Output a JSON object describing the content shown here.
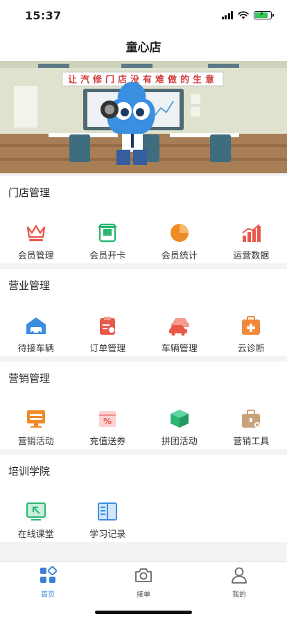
{
  "status_bar": {
    "time": "15:37"
  },
  "header": {
    "title": "童心店"
  },
  "banner": {
    "slogan": "让汽修门店没有难做的生意"
  },
  "sections": [
    {
      "title": "门店管理",
      "items": [
        {
          "label": "会员管理",
          "icon": "crown-icon",
          "color": "#e8594a"
        },
        {
          "label": "会员开卡",
          "icon": "card-machine-icon",
          "color": "#2bb673"
        },
        {
          "label": "会员统计",
          "icon": "pie-chart-icon",
          "color": "#f08a24"
        },
        {
          "label": "运营数据",
          "icon": "bar-chart-icon",
          "color": "#e8594a"
        }
      ]
    },
    {
      "title": "营业管理",
      "items": [
        {
          "label": "待接车辆",
          "icon": "car-garage-icon",
          "color": "#3b8ee0"
        },
        {
          "label": "订单管理",
          "icon": "clipboard-icon",
          "color": "#e8594a"
        },
        {
          "label": "车辆管理",
          "icon": "cars-icon",
          "color": "#e8594a"
        },
        {
          "label": "云诊断",
          "icon": "medical-box-icon",
          "color": "#f08a3a"
        }
      ]
    },
    {
      "title": "营销管理",
      "items": [
        {
          "label": "营销活动",
          "icon": "monitor-icon",
          "color": "#f08a24"
        },
        {
          "label": "充值送券",
          "icon": "coupon-icon",
          "color": "#f28b8b"
        },
        {
          "label": "拼团活动",
          "icon": "box-icon",
          "color": "#2bb673"
        },
        {
          "label": "营销工具",
          "icon": "toolbox-icon",
          "color": "#c9a27a"
        }
      ]
    },
    {
      "title": "培训学院",
      "items": [
        {
          "label": "在线课堂",
          "icon": "online-class-icon",
          "color": "#2bb673"
        },
        {
          "label": "学习记录",
          "icon": "book-icon",
          "color": "#3b8ee0"
        }
      ]
    }
  ],
  "tabs": [
    {
      "label": "首页",
      "icon": "home-grid-icon",
      "active": true
    },
    {
      "label": "接单",
      "icon": "camera-icon",
      "active": false
    },
    {
      "label": "我的",
      "icon": "user-icon",
      "active": false
    }
  ]
}
